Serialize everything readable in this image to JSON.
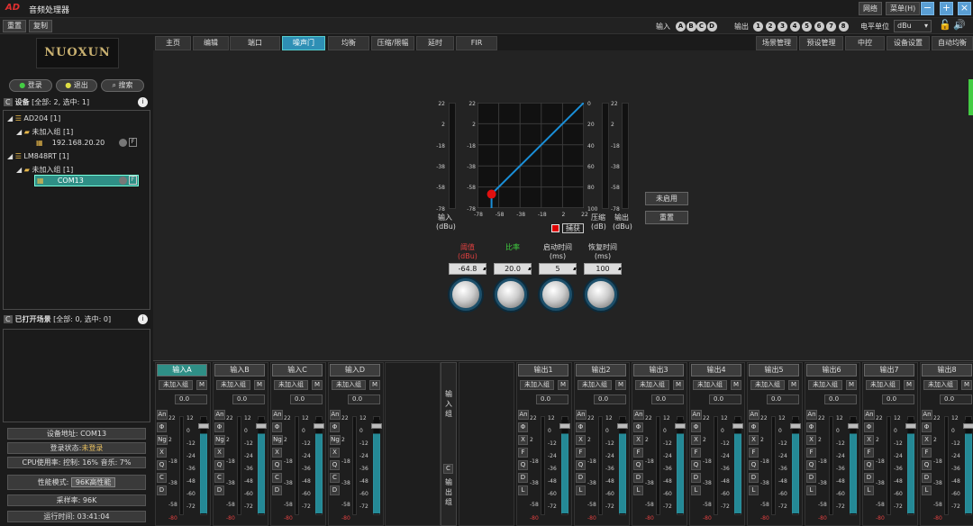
{
  "app": {
    "title": "音频处理器",
    "logo": "AD",
    "network_btn": "网络",
    "menu_btn": "菜单(H)"
  },
  "toolbar": {
    "reset": "重置",
    "copy": "复制",
    "input_label": "输入",
    "inputs": [
      "A",
      "B",
      "C",
      "D"
    ],
    "output_label": "输出",
    "outputs": [
      "1",
      "2",
      "3",
      "4",
      "5",
      "6",
      "7",
      "8"
    ],
    "unit_label": "电平单位",
    "unit_value": "dBu"
  },
  "sidebar": {
    "brand": "NUOXUN",
    "login": "登录",
    "logout": "退出",
    "search": "搜索",
    "devices_header": "设备",
    "devices_summary": "[全部: 2, 选中: 1]",
    "tree": [
      {
        "name": "AD204 [1]",
        "group": "未加入组 [1]",
        "item": "192.168.20.20"
      },
      {
        "name": "LM848RT [1]",
        "group": "未加入组 [1]",
        "item": "COM13"
      }
    ],
    "scenes_header": "已打开场景",
    "scenes_summary": "[全部: 0, 选中: 0]",
    "status": {
      "address": "设备地址: COM13",
      "login_state_label": "登录状态:",
      "login_state": "未登录",
      "cpu": "CPU使用率: 控制: 16% 音乐: 7%",
      "perf_label": "性能模式:",
      "perf_value": "96K高性能",
      "sample_rate": "采样率: 96K",
      "uptime": "运行时间: 03:41:04"
    }
  },
  "tabs": [
    "主页",
    "编辑",
    "端口",
    "噪声门",
    "均衡",
    "压缩/限幅",
    "延时",
    "FIR"
  ],
  "active_tab": "噪声门",
  "right_tabs": [
    "场景管理",
    "预设管理",
    "中控",
    "设备设置",
    "自动均衡"
  ],
  "gate": {
    "meter_scale_left": [
      "22",
      "2",
      "-18",
      "-38",
      "-58",
      "-78"
    ],
    "graph_y": [
      "22",
      "2",
      "-18",
      "-38",
      "-58",
      "-78"
    ],
    "graph_x": [
      "-78",
      "-58",
      "-38",
      "-18",
      "2",
      "22"
    ],
    "comp_scale": [
      "0",
      "20",
      "40",
      "60",
      "80",
      "100"
    ],
    "meter_scale_right": [
      "22",
      "2",
      "-18",
      "-38",
      "-58",
      "-78"
    ],
    "input_label": "输入",
    "input_unit": "(dBu)",
    "comp_label": "压缩",
    "comp_unit": "(dB)",
    "output_label": "输出",
    "output_unit": "(dBu)",
    "capture": "捕获",
    "bypass_btn": "未启用",
    "reset_btn": "重置",
    "params": [
      {
        "label": "阈值",
        "unit": "(dBu)",
        "value": "-64.8",
        "color": "#e04040"
      },
      {
        "label": "比率",
        "unit": "",
        "value": "20.0",
        "color": "#40d040"
      },
      {
        "label": "启动时间",
        "unit": "(ms)",
        "value": "5",
        "color": "#dddddd"
      },
      {
        "label": "恢复时间",
        "unit": "(ms)",
        "value": "100",
        "color": "#dddddd"
      }
    ],
    "threshold_point": {
      "x": -64.8,
      "y": -64.8
    },
    "accent_color": "#1a8fd8"
  },
  "mixer": {
    "inputs": [
      {
        "name": "输入A",
        "active": true
      },
      {
        "name": "输入B",
        "active": false
      },
      {
        "name": "输入C",
        "active": false
      },
      {
        "name": "输入D",
        "active": false
      }
    ],
    "outputs": [
      "输出1",
      "输出2",
      "输出3",
      "输出4",
      "输出5",
      "输出6",
      "输出7",
      "输出8"
    ],
    "group_btn": "未加入组",
    "mute_btn": "M",
    "gain": "0.0",
    "input_side": [
      "An",
      "Φ",
      "Ng",
      "X",
      "Q",
      "C",
      "D"
    ],
    "output_side": [
      "An",
      "Φ",
      "X",
      "F",
      "Q",
      "D",
      "L"
    ],
    "scale_in": [
      "22",
      "2",
      "-18",
      "-38",
      "-58"
    ],
    "scale_f": [
      "12",
      "0",
      "-12",
      "-24",
      "-36",
      "-48",
      "-60",
      "-72"
    ],
    "scale_f_out": [
      "12",
      "0",
      "-12",
      "-24",
      "-36",
      "-48",
      "-60",
      "-72"
    ],
    "bottom_low": "-80",
    "input_group_label": "输入组",
    "output_group_label": "输出组",
    "c_btn": "C"
  }
}
